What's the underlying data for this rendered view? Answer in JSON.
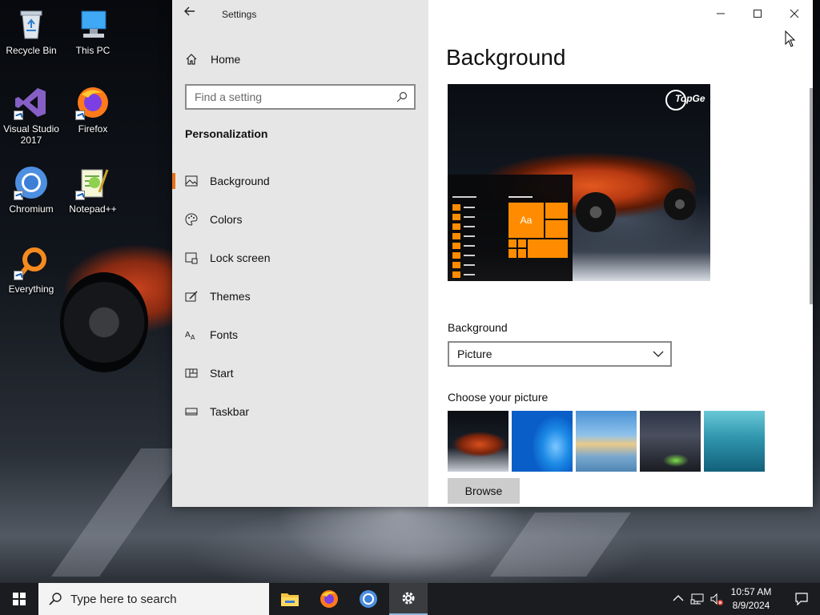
{
  "desktop": {
    "icons": [
      {
        "label": "Recycle Bin",
        "icon": "recycle-bin-icon"
      },
      {
        "label": "This PC",
        "icon": "this-pc-icon"
      },
      {
        "label": "Visual Studio 2017",
        "icon": "visual-studio-icon"
      },
      {
        "label": "Firefox",
        "icon": "firefox-icon"
      },
      {
        "label": "Chromium",
        "icon": "chromium-icon"
      },
      {
        "label": "Notepad++",
        "icon": "notepadpp-icon"
      },
      {
        "label": "Everything",
        "icon": "everything-icon"
      }
    ]
  },
  "window": {
    "title": "Settings",
    "nav": {
      "home_label": "Home",
      "search_placeholder": "Find a setting",
      "section_title": "Personalization",
      "items": [
        {
          "label": "Background",
          "icon": "background-icon",
          "active": true
        },
        {
          "label": "Colors",
          "icon": "palette-icon",
          "active": false
        },
        {
          "label": "Lock screen",
          "icon": "lock-screen-icon",
          "active": false
        },
        {
          "label": "Themes",
          "icon": "themes-icon",
          "active": false
        },
        {
          "label": "Fonts",
          "icon": "fonts-icon",
          "active": false
        },
        {
          "label": "Start",
          "icon": "start-icon",
          "active": false
        },
        {
          "label": "Taskbar",
          "icon": "taskbar-icon",
          "active": false
        }
      ]
    },
    "content": {
      "page_title": "Background",
      "preview": {
        "tile_text": "Aa",
        "logo_text": "TopGe"
      },
      "background_label": "Background",
      "background_value": "Picture",
      "choose_label": "Choose your picture",
      "browse_label": "Browse"
    }
  },
  "taskbar": {
    "search_placeholder": "Type here to search",
    "time": "10:57 AM",
    "date": "8/9/2024",
    "accent_color": "#e8701a"
  }
}
